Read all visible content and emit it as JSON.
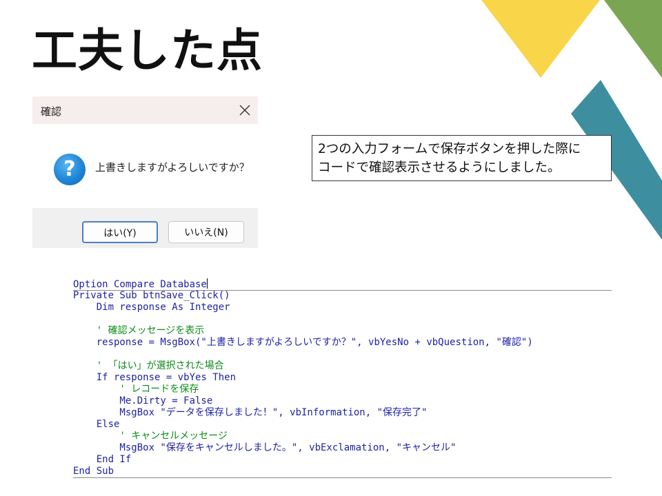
{
  "slide": {
    "title": "工夫した点",
    "colors": {
      "yellow": "#f9d54a",
      "green": "#7aa552",
      "teal": "#3d8f9f"
    }
  },
  "dialog": {
    "title": "確認",
    "close_icon": "close-icon",
    "icon": "question-icon",
    "message": "上書きしますがよろしいですか？",
    "yes_label": "はい(Y)",
    "no_label": "いいえ(N)"
  },
  "note": {
    "line1": "2つの入力フォームで保存ボタンを押した際に",
    "line2": "コードで確認表示させるようにしました。"
  },
  "code": {
    "lines": [
      "Option Compare Database",
      "Private Sub btnSave_Click()",
      "    Dim response As Integer",
      "",
      "    ' 確認メッセージを表示",
      "    response = MsgBox(\"上書きしますがよろしいですか？\", vbYesNo + vbQuestion, \"確認\")",
      "",
      "    ' 「はい」が選択された場合",
      "    If response = vbYes Then",
      "        ' レコードを保存",
      "        Me.Dirty = False",
      "        MsgBox \"データを保存しました！\", vbInformation, \"保存完了\"",
      "    Else",
      "        ' キャンセルメッセージ",
      "        MsgBox \"保存をキャンセルしました。\", vbExclamation, \"キャンセル\"",
      "    End If",
      "End Sub"
    ]
  }
}
